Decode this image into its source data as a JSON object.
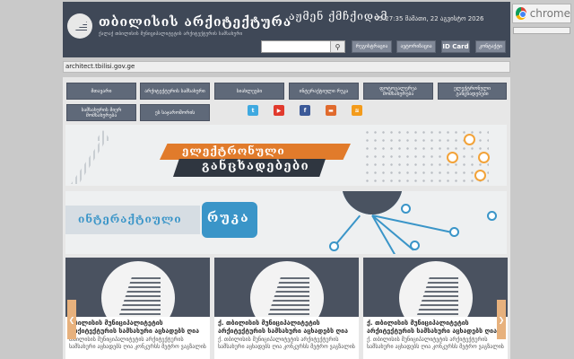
{
  "header": {
    "logo_title": "თბილისის არქიტექტურა",
    "logo_subtitle": "ქალაქ თბილისის მუნიციპალიტეტის არქიტექტურის სამსახური",
    "slogan": "აჟმენ ქმჩქიდამ",
    "datetime": "05:27:35 მამათი, 22 აგვისტო 2026",
    "search": {
      "placeholder": "",
      "value": ""
    },
    "buttons": [
      "რეგისტრაცია",
      "ავტორიზაცია",
      "ID Card",
      "კონტაქტი"
    ]
  },
  "browser": {
    "chrome_label": "chrome",
    "address": "architect.tbilisi.gov.ge"
  },
  "nav": {
    "row1": [
      "მთავარი",
      "არქიტექტურის სამსახური",
      "სიახლეები",
      "ინტერაქტიული რუკა",
      "ფოტოგალერეა მომსახურება",
      "ელექტრონული განცხადებები"
    ],
    "row2": [
      "სამსახურის მიერ მომსახურება",
      "ეს საჯაროშორის"
    ]
  },
  "social": [
    "twitter-icon",
    "youtube-icon",
    "facebook-icon",
    "blog-icon",
    "rss-icon"
  ],
  "banners": {
    "electronic_top": "ელექტრონული",
    "electronic_bottom": "განცხადებები",
    "interactive_left": "ინტერაქტიული",
    "interactive_right": "რუკა"
  },
  "cards": [
    {
      "title": "თბილისის მუნიციპალიტეტის არქიტექტურის სამსახური აცხადებს ღია",
      "text": "თბილისის მუნიციპალიტეტის არქიტექტურის სამსახური აცხადებს ღია კონკურსს მეტრო ვაგზალის"
    },
    {
      "title": "ქ. თბილისის მუნიციპალიტეტის არქიტექტურის სამსახური აცხადებს ღია",
      "text": "ქ. თბილისის მუნიციპალიტეტის არქიტექტურის სამსახური აცხადებს ღია კონკურსს მეტრო ვაგზალის"
    },
    {
      "title": "ქ. თბილისის მუნიციპალიტეტის არქიტექტურის სამსახური აცხადებს ღია",
      "text": "ქ. თბილისის მუნიციპალიტეტის არქიტექტურის სამსახური აცხადებს ღია კონკურსს მეტრო ვაგზალის"
    }
  ],
  "colors": {
    "header_bg": "#3f4857",
    "accent_orange": "#e17b2b",
    "accent_blue": "#3a95c8"
  }
}
